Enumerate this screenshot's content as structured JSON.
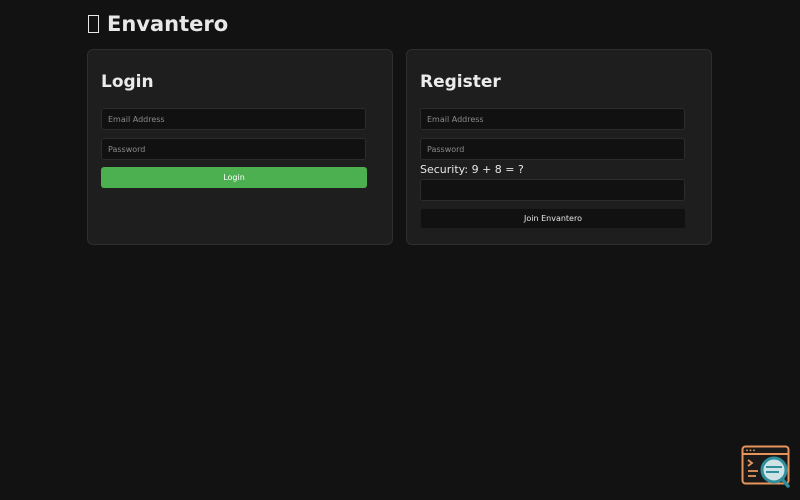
{
  "app": {
    "title": "Envantero"
  },
  "login": {
    "heading": "Login",
    "email_placeholder": "Email Address",
    "password_placeholder": "Password",
    "submit_label": "Login"
  },
  "register": {
    "heading": "Register",
    "email_placeholder": "Email Address",
    "password_placeholder": "Password",
    "security_question": "Security: 9 + 8 = ?",
    "security_answer": "",
    "submit_label": "Join Envantero"
  },
  "icons": {
    "brand": "missing-glyph-icon",
    "corner_widget": "browser-search-icon"
  },
  "colors": {
    "background": "#121212",
    "card": "#1e1e1e",
    "accent_green": "#4caf50",
    "widget_orange": "#e8945a",
    "widget_teal": "#2f8f9d"
  }
}
